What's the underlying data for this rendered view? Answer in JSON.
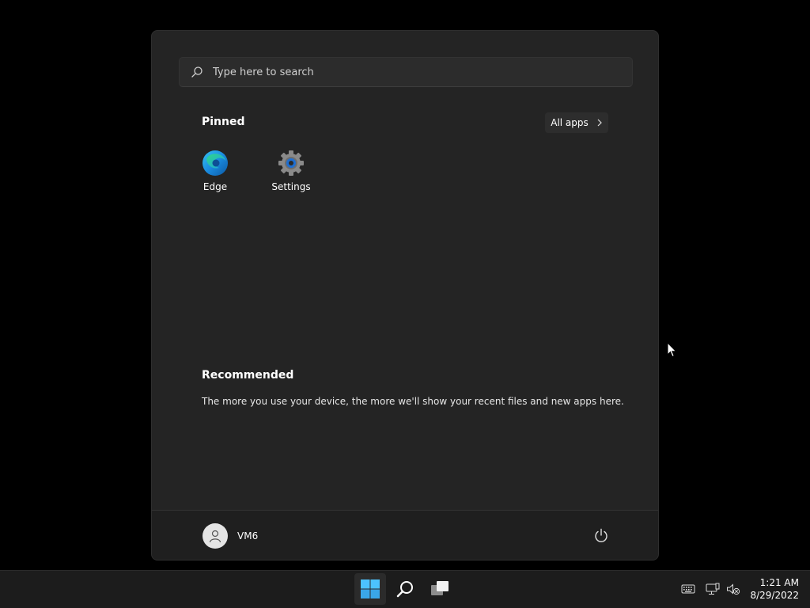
{
  "search": {
    "placeholder": "Type here to search"
  },
  "pinned": {
    "title": "Pinned",
    "all_apps_label": "All apps",
    "apps": [
      {
        "label": "Edge",
        "icon": "edge-icon"
      },
      {
        "label": "Settings",
        "icon": "settings-gear-icon"
      }
    ]
  },
  "recommended": {
    "title": "Recommended",
    "message": "The more you use your device, the more we'll show your recent files and new apps here."
  },
  "user": {
    "name": "VM6"
  },
  "taskbar": {
    "buttons": [
      "windows-start-icon",
      "search-icon",
      "task-view-icon"
    ],
    "tray": [
      "keyboard-icon",
      "network-icon",
      "volume-muted-icon"
    ],
    "time": "1:21 AM",
    "date": "8/29/2022"
  },
  "colors": {
    "menu_bg": "#242424",
    "footer_bg": "#1f1f1f",
    "taskbar_bg": "#1c1c1c",
    "accent": "#4cc2ff"
  }
}
